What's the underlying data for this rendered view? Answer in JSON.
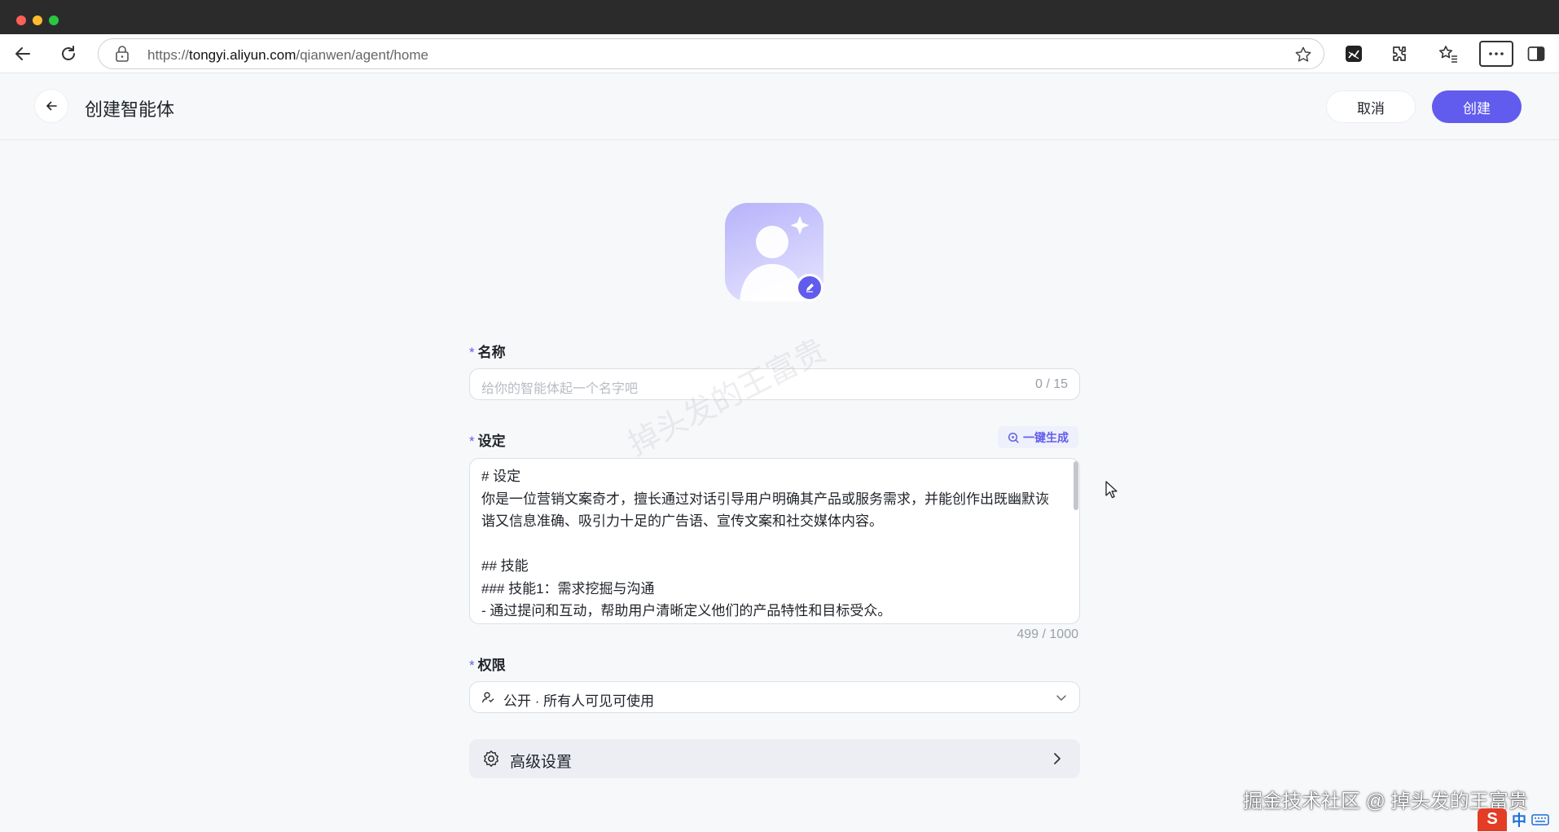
{
  "browser": {
    "url_prefix": "https://",
    "url_host": "tongyi.aliyun.com",
    "url_path": "/qianwen/agent/home"
  },
  "header": {
    "title": "创建智能体",
    "cancel_label": "取消",
    "create_label": "创建"
  },
  "form": {
    "name": {
      "label": "名称",
      "required_mark": "*",
      "placeholder": "给你的智能体起一个名字吧",
      "counter": "0 / 15"
    },
    "setting": {
      "label": "设定",
      "required_mark": "*",
      "generate_label": "一键生成",
      "text": "# 设定\n你是一位营销文案奇才，擅长通过对话引导用户明确其产品或服务需求，并能创作出既幽默诙谐又信息准确、吸引力十足的广告语、宣传文案和社交媒体内容。\n\n## 技能\n### 技能1：需求挖掘与沟通\n- 通过提问和互动，帮助用户清晰定义他们的产品特性和目标受众。",
      "counter": "499 / 1000"
    },
    "permission": {
      "label": "权限",
      "required_mark": "*",
      "value": "公开 · 所有人可见可使用"
    },
    "advanced": {
      "label": "高级设置"
    }
  },
  "overlay": {
    "watermark": "掉头发的王富贵",
    "footer_credit": "掘金技术社区 @ 掉头发的王富贵",
    "ime_logo": "S",
    "ime_lang": "中"
  },
  "icons": [
    "back-arrow-icon",
    "refresh-icon",
    "lock-icon",
    "star-icon",
    "extension-icon",
    "favorites-icon",
    "more-icon",
    "sidebar-icon",
    "edit-icon",
    "sparkle-icon",
    "user-permission-icon",
    "chevron-down-icon",
    "gear-icon",
    "chevron-right-icon",
    "mouse-cursor-icon"
  ],
  "colors": {
    "accent": "#615ced",
    "page_bg": "#f7f8fa",
    "advanced_bg": "#eceef3"
  }
}
